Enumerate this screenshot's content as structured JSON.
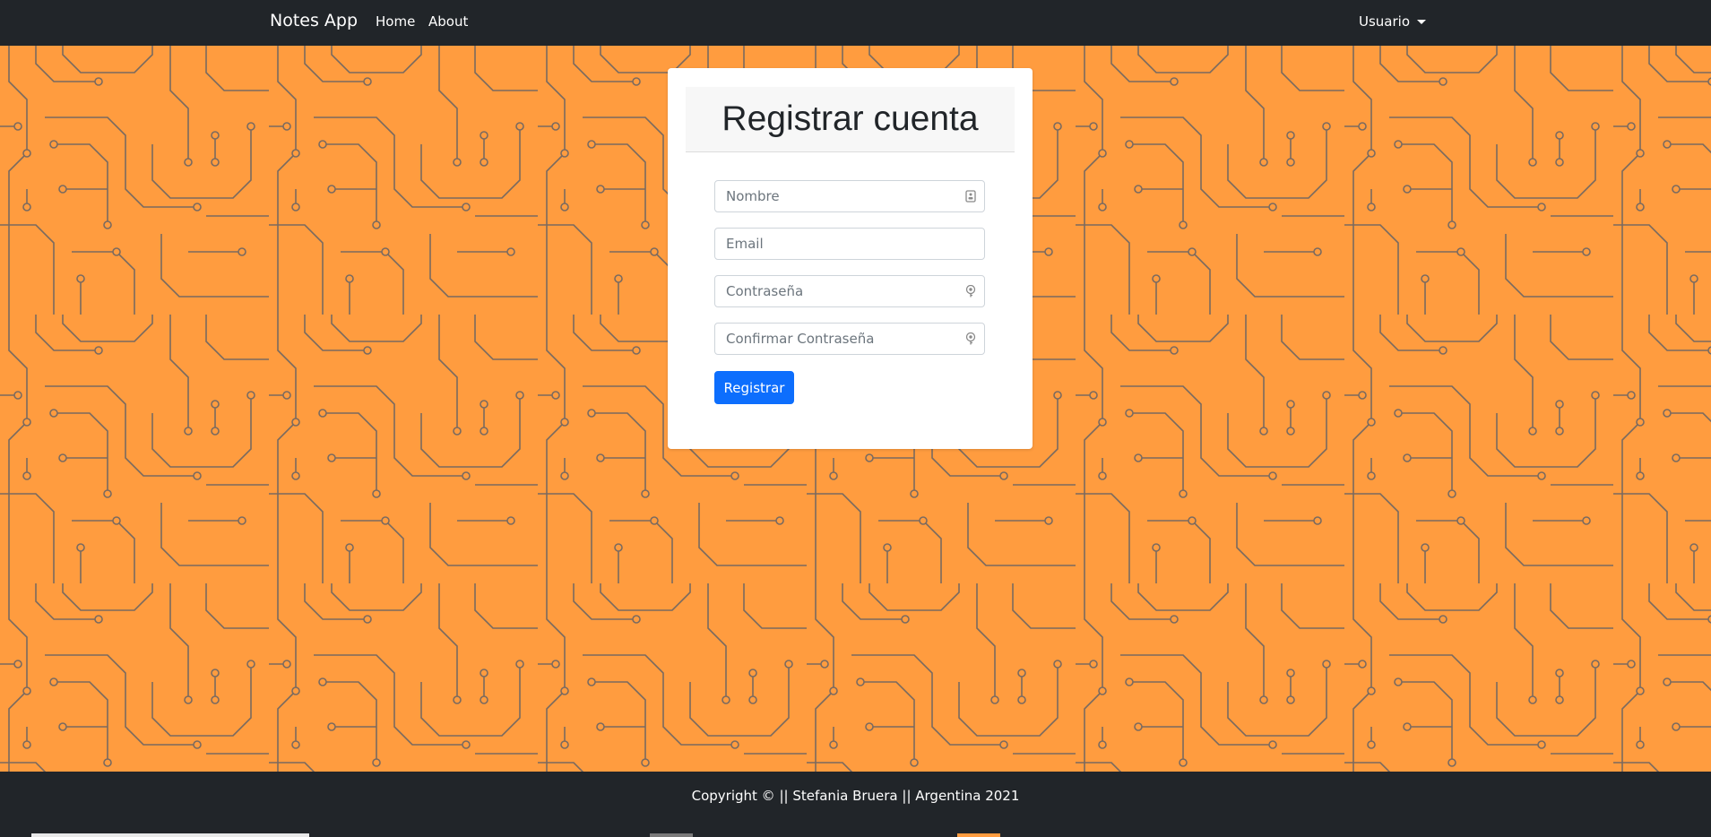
{
  "navbar": {
    "brand": "Notes App",
    "links": [
      "Home",
      "About"
    ],
    "user_menu": "Usuario"
  },
  "card": {
    "title": "Registrar cuenta",
    "fields": {
      "name_placeholder": "Nombre",
      "email_placeholder": "Email",
      "password_placeholder": "Contraseña",
      "confirm_placeholder": "Confirmar Contraseña"
    },
    "submit_label": "Registrar"
  },
  "footer": {
    "copyright": "Copyright © || Stefania Bruera || Argentina 2021"
  },
  "colors": {
    "navbar_bg": "#212529",
    "background_orange": "#ff9c3f",
    "circuit_line": "#7a6a5f",
    "primary_button": "#0d6efd"
  },
  "icons": [
    "id-card-icon",
    "key-icon",
    "key-icon"
  ]
}
